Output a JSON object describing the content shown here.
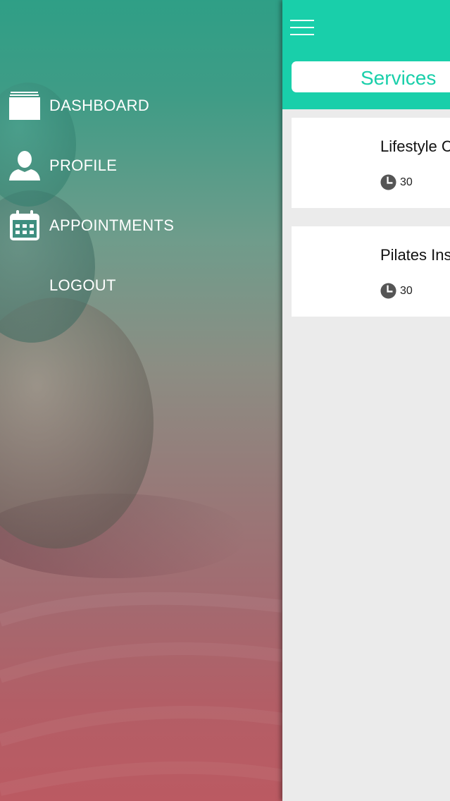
{
  "drawer": {
    "items": [
      {
        "label": "DASHBOARD",
        "icon": "dashboard-icon"
      },
      {
        "label": "PROFILE",
        "icon": "user-icon"
      },
      {
        "label": "APPOINTMENTS",
        "icon": "calendar-icon"
      },
      {
        "label": "LOGOUT",
        "icon": ""
      }
    ]
  },
  "header": {
    "menu_icon": "hamburger-icon",
    "tab_label": "Services",
    "accent_color": "#19cfaa"
  },
  "services": [
    {
      "title": "Lifestyle C",
      "duration": "30"
    },
    {
      "title": "Pilates Ins",
      "duration": "30"
    }
  ]
}
